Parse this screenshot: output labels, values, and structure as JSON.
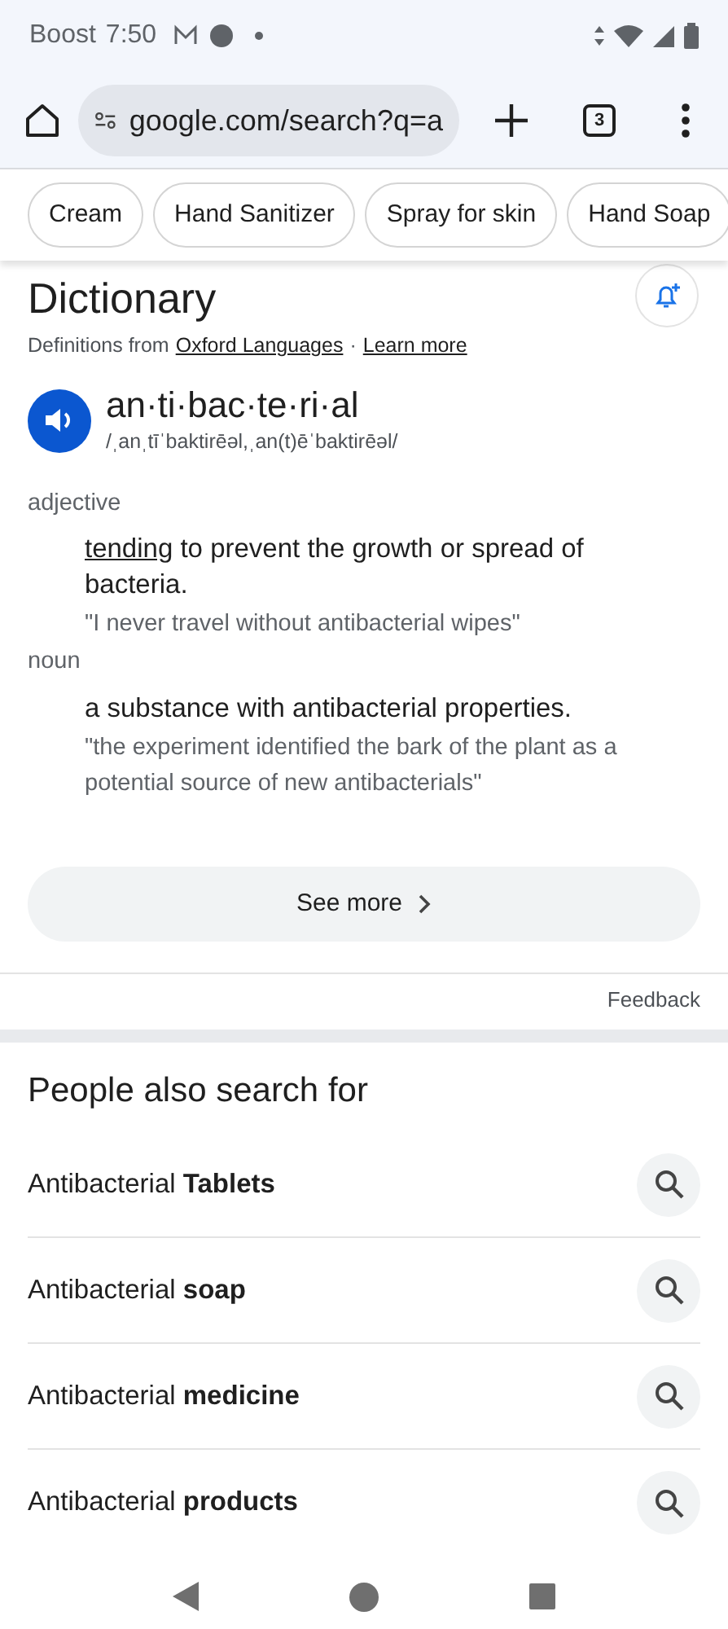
{
  "status_bar": {
    "carrier": "Boost",
    "time": "7:50"
  },
  "toolbar": {
    "url": "google.com/search?q=a",
    "tab_count": "3"
  },
  "chips": [
    {
      "label": "Cream"
    },
    {
      "label": "Hand Sanitizer"
    },
    {
      "label": "Spray for skin"
    },
    {
      "label": "Hand Soap"
    }
  ],
  "dictionary": {
    "title": "Dictionary",
    "source_prefix": "Definitions from",
    "source_link": "Oxford Languages",
    "separator": "·",
    "learn_more": "Learn more",
    "word": "an·ti·bac·te·ri·al",
    "pronunciation": "/ˌanˌtīˈbaktirēəl,ˌan(t)ēˈbaktirēəl/",
    "senses": [
      {
        "part_of_speech": "adjective",
        "link": "tending",
        "definition": " to prevent the growth or spread of bacteria.",
        "example": "\"I never travel without antibacterial wipes\""
      },
      {
        "part_of_speech": "noun",
        "definition": "a substance with antibacterial properties.",
        "example": "\"the experiment identified the bark of the plant as a potential source of new antibacterials\""
      }
    ],
    "see_more": "See more",
    "feedback": "Feedback"
  },
  "people_also_search": {
    "title": "People also search for",
    "items": [
      {
        "label": "Antibacterial **Tablets**"
      },
      {
        "label": "Antibacterial **soap**"
      },
      {
        "label": "Antibacterial **medicine**"
      },
      {
        "label": "Antibacterial **products**"
      }
    ]
  }
}
